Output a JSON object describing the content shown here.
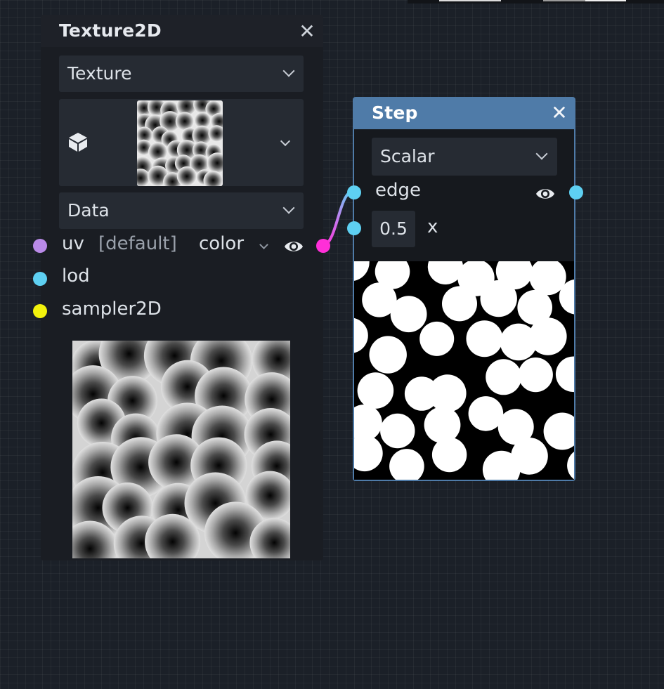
{
  "texture_node": {
    "title": "Texture2D",
    "close_symbol": "✕",
    "texture_select": "Texture",
    "picker_icon": "cube-icon",
    "data_select": "Data",
    "inputs": [
      {
        "name": "uv",
        "hint": "[default]",
        "color": "#b98ae8"
      },
      {
        "name": "lod",
        "color": "#5ed0f2"
      },
      {
        "name": "sampler2D",
        "color": "#f2f20c"
      }
    ],
    "output": {
      "name": "color",
      "color": "#ff2fd8"
    }
  },
  "step_node": {
    "title": "Step",
    "close_symbol": "✕",
    "type_select": "Scalar",
    "edge_label": "edge",
    "x_label": "x",
    "x_value": "0.5",
    "port_color": "#5ed0f2",
    "header_color": "#4f7ba8"
  }
}
